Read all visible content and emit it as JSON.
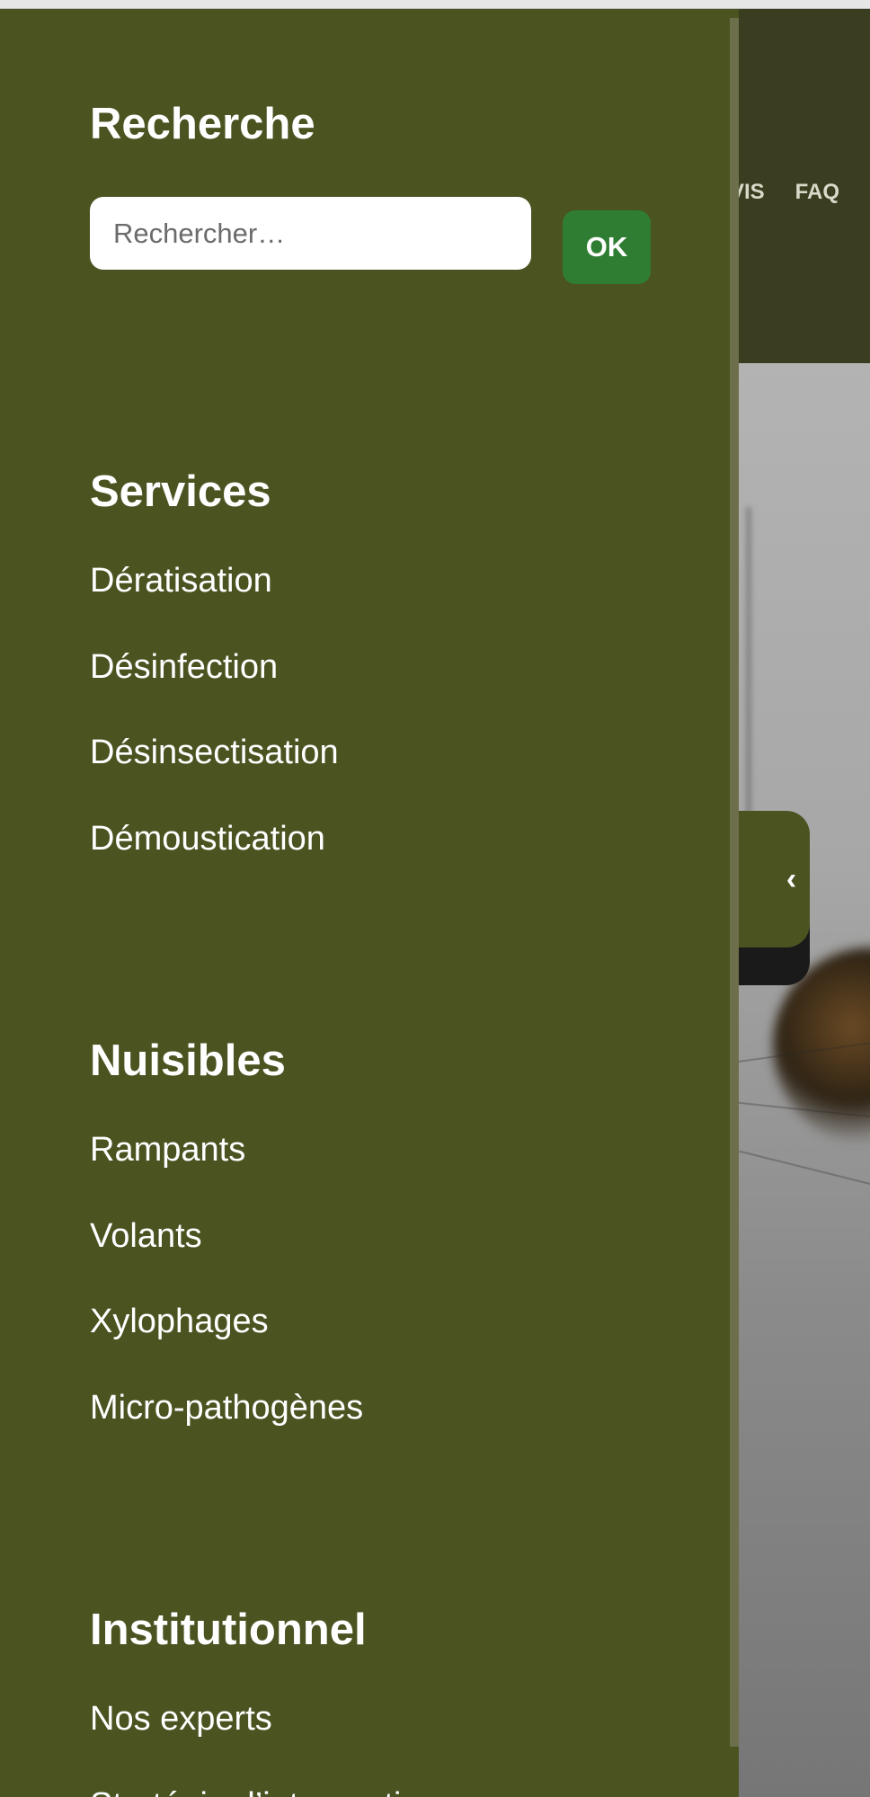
{
  "background": {
    "nav_items": [
      "VIS",
      "FAQ"
    ]
  },
  "drawer": {
    "search": {
      "title": "Recherche",
      "placeholder": "Rechercher…",
      "button_label": "OK"
    },
    "services": {
      "title": "Services",
      "items": [
        "Dératisation",
        "Désinfection",
        "Désinsectisation",
        "Démoustication"
      ]
    },
    "nuisibles": {
      "title": "Nuisibles",
      "items": [
        "Rampants",
        "Volants",
        "Xylophages",
        "Micro-pathogènes"
      ]
    },
    "institutionnel": {
      "title": "Institutionnel",
      "items": [
        "Nos experts",
        "Stratégie d’intervention"
      ]
    },
    "toggle_icon": "chevron-left-icon"
  },
  "colors": {
    "drawer_bg": "#4b5321",
    "header_bg": "#3a3d1f",
    "ok_button": "#2f7d32",
    "text": "#ffffff"
  }
}
